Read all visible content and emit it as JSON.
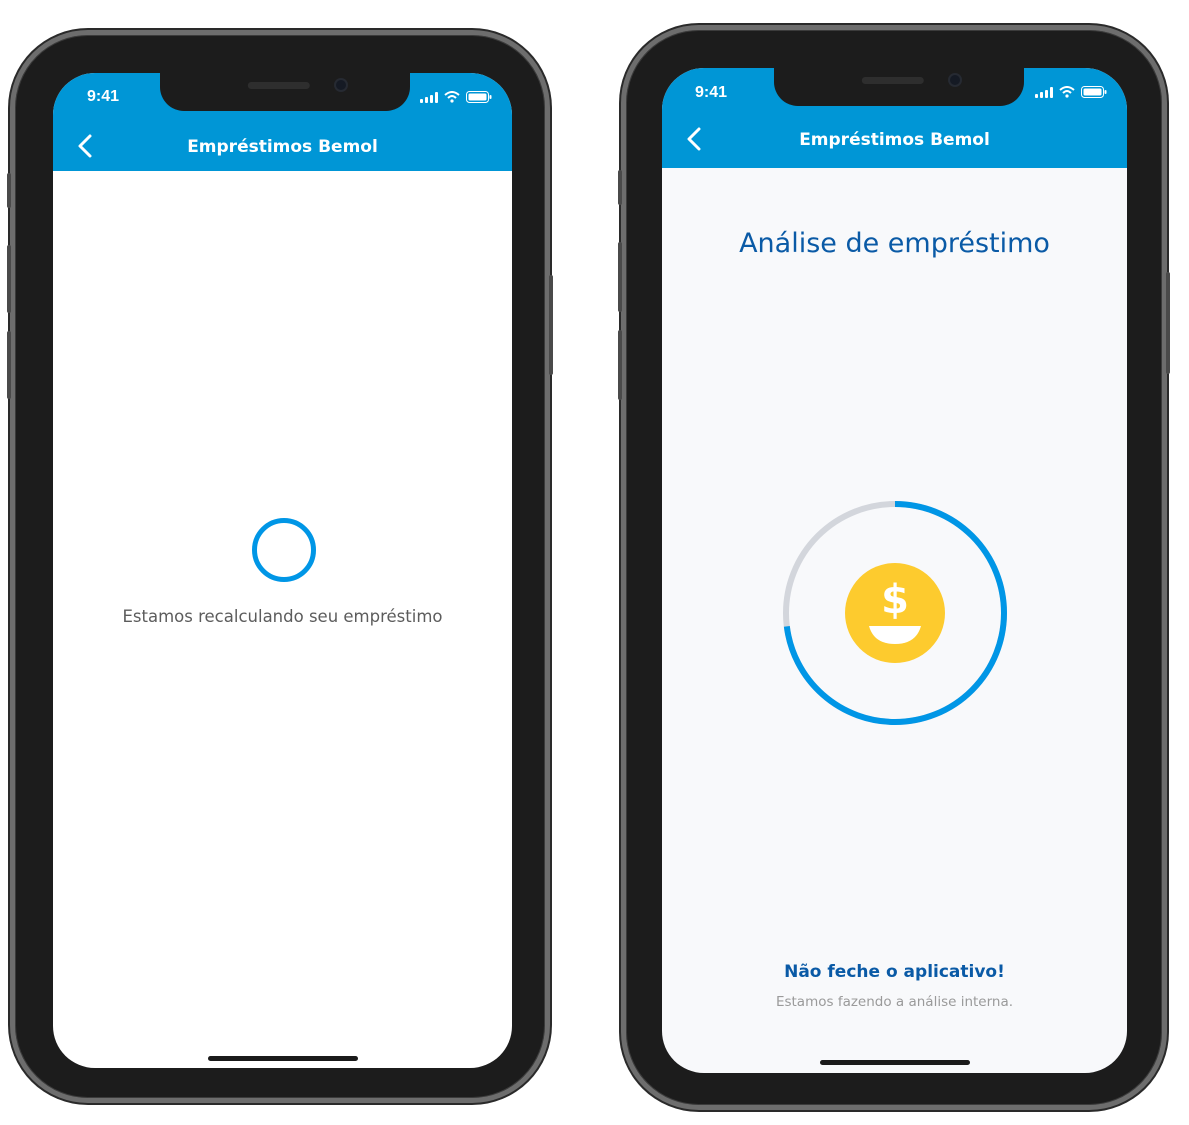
{
  "left_phone": {
    "status_time": "9:41",
    "title": "Empréstimos Bemol",
    "loading_text": "Estamos recalculando seu empréstimo"
  },
  "right_phone": {
    "status_time": "9:41",
    "title": "Empréstimos Bemol",
    "heading": "Análise de empréstimo",
    "progress_fraction": 0.73,
    "coin_symbol": "$",
    "warning_title": "Não feche o aplicativo!",
    "warning_subtitle": "Estamos fazendo a análise interna."
  },
  "colors": {
    "appbar": "#0096d6",
    "accent_blue": "#0096e6",
    "heading_blue": "#0a5aa6",
    "coin_yellow": "#fdcb2e",
    "track_gray": "#d3d6dc"
  },
  "icons": [
    "back-chevron-icon",
    "signal-icon",
    "wifi-icon",
    "battery-icon",
    "dollar-coin-icon"
  ]
}
